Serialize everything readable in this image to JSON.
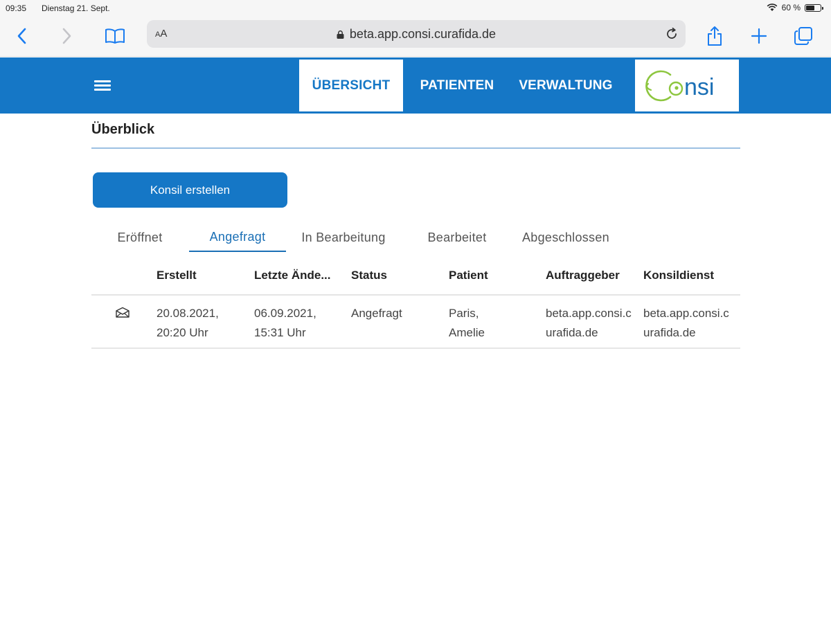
{
  "statusbar": {
    "time": "09:35",
    "date": "Dienstag 21. Sept.",
    "battery": "60 %",
    "battery_level": 0.6
  },
  "browser": {
    "aa_small": "A",
    "aa_large": "A",
    "url": "beta.app.consi.curafida.de"
  },
  "header": {
    "nav": [
      "ÜBERSICHT",
      "PATIENTEN",
      "VERWALTUNG"
    ],
    "logo_text": "nsi",
    "logo_colors": {
      "ring": "#8dc63f",
      "text": "#1a6fb5"
    }
  },
  "page": {
    "title": "Überblick",
    "create_button": "Konsil erstellen",
    "tabs": [
      "Eröffnet",
      "Angefragt",
      "In Bearbeitung",
      "Bearbeitet",
      "Abgeschlossen"
    ],
    "active_tab": "Angefragt"
  },
  "table": {
    "columns": [
      "Erstellt",
      "Letzte Ände...",
      "Status",
      "Patient",
      "Auftraggeber",
      "Konsildienst"
    ],
    "rows": [
      {
        "icon": "envelope-icon",
        "created": [
          "20.08.2021,",
          "20:20 Uhr"
        ],
        "changed": [
          "06.09.2021,",
          "15:31 Uhr"
        ],
        "status": "Angefragt",
        "patient": [
          "Paris,",
          "Amelie"
        ],
        "client": [
          "beta.app.consi.c",
          "urafida.de"
        ],
        "service": [
          "beta.app.consi.c",
          "urafida.de"
        ]
      }
    ]
  },
  "colors": {
    "brand": "#1577c6",
    "tab_active": "#1a6fb5"
  }
}
